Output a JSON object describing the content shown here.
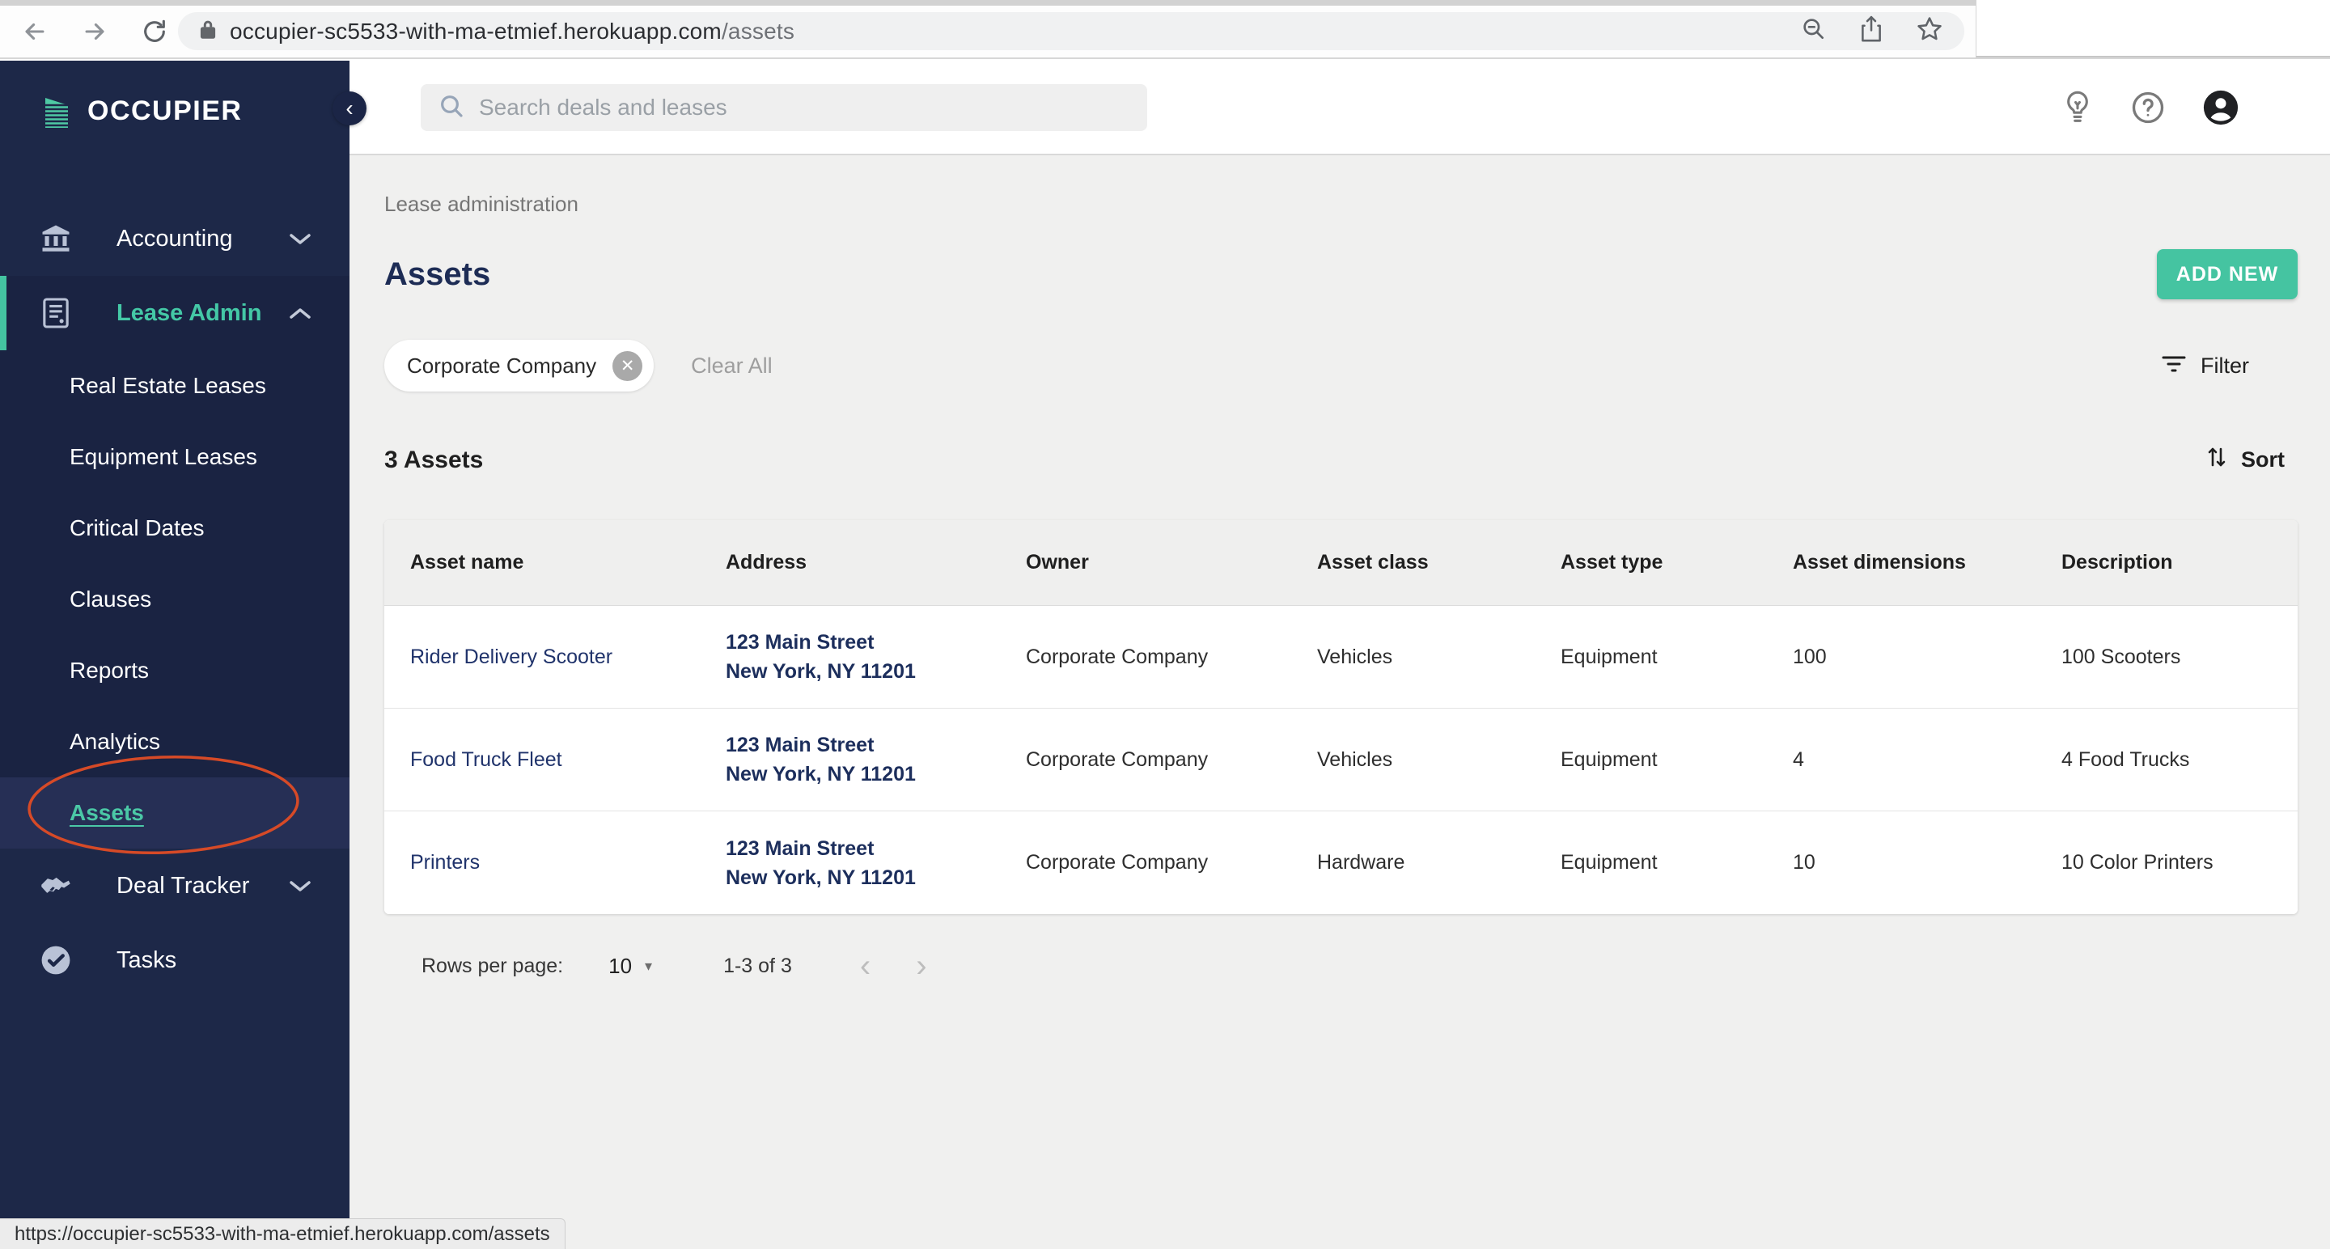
{
  "colors": {
    "accent_teal": "#45C4A1",
    "sidebar_navy": "#1D2848",
    "link_navy": "#20336B",
    "annotation_red": "#D64A27"
  },
  "icons": {
    "back": "←",
    "forward": "→",
    "close": "✕",
    "collapse": "‹",
    "dropdown": "▾",
    "prev": "‹",
    "next": "›"
  },
  "browser": {
    "url_host": "occupier-sc5533-with-ma-etmief.herokuapp.com",
    "url_path": "/assets",
    "status_url": "https://occupier-sc5533-with-ma-etmief.herokuapp.com/assets"
  },
  "sidebar": {
    "logo_text": "OCCUPIER",
    "items": [
      {
        "label": "Accounting"
      },
      {
        "label": "Lease Admin"
      },
      {
        "label": "Real Estate Leases"
      },
      {
        "label": "Equipment Leases"
      },
      {
        "label": "Critical Dates"
      },
      {
        "label": "Clauses"
      },
      {
        "label": "Reports"
      },
      {
        "label": "Analytics"
      },
      {
        "label": "Assets"
      },
      {
        "label": "Deal Tracker"
      },
      {
        "label": "Tasks"
      }
    ]
  },
  "header": {
    "search_placeholder": "Search deals and leases"
  },
  "page": {
    "breadcrumb": "Lease administration",
    "title": "Assets",
    "add_button": "ADD NEW",
    "filter_chip": "Corporate Company",
    "clear_all": "Clear All",
    "filter_label": "Filter",
    "count_label": "3 Assets",
    "sort_label": "Sort"
  },
  "table": {
    "columns": [
      "Asset name",
      "Address",
      "Owner",
      "Asset class",
      "Asset type",
      "Asset dimensions",
      "Description"
    ],
    "rows": [
      {
        "name": "Rider Delivery Scooter",
        "address_line1": "123 Main Street",
        "address_line2": "New York, NY 11201",
        "owner": "Corporate Company",
        "asset_class": "Vehicles",
        "asset_type": "Equipment",
        "dimensions": "100",
        "description": "100 Scooters"
      },
      {
        "name": "Food Truck Fleet",
        "address_line1": "123 Main Street",
        "address_line2": "New York, NY 11201",
        "owner": "Corporate Company",
        "asset_class": "Vehicles",
        "asset_type": "Equipment",
        "dimensions": "4",
        "description": "4 Food Trucks"
      },
      {
        "name": "Printers",
        "address_line1": "123 Main Street",
        "address_line2": "New York, NY 11201",
        "owner": "Corporate Company",
        "asset_class": "Hardware",
        "asset_type": "Equipment",
        "dimensions": "10",
        "description": "10 Color Printers"
      }
    ]
  },
  "pagination": {
    "rows_per_page_label": "Rows per page:",
    "rows_per_page_value": "10",
    "range_label": "1-3 of 3"
  }
}
